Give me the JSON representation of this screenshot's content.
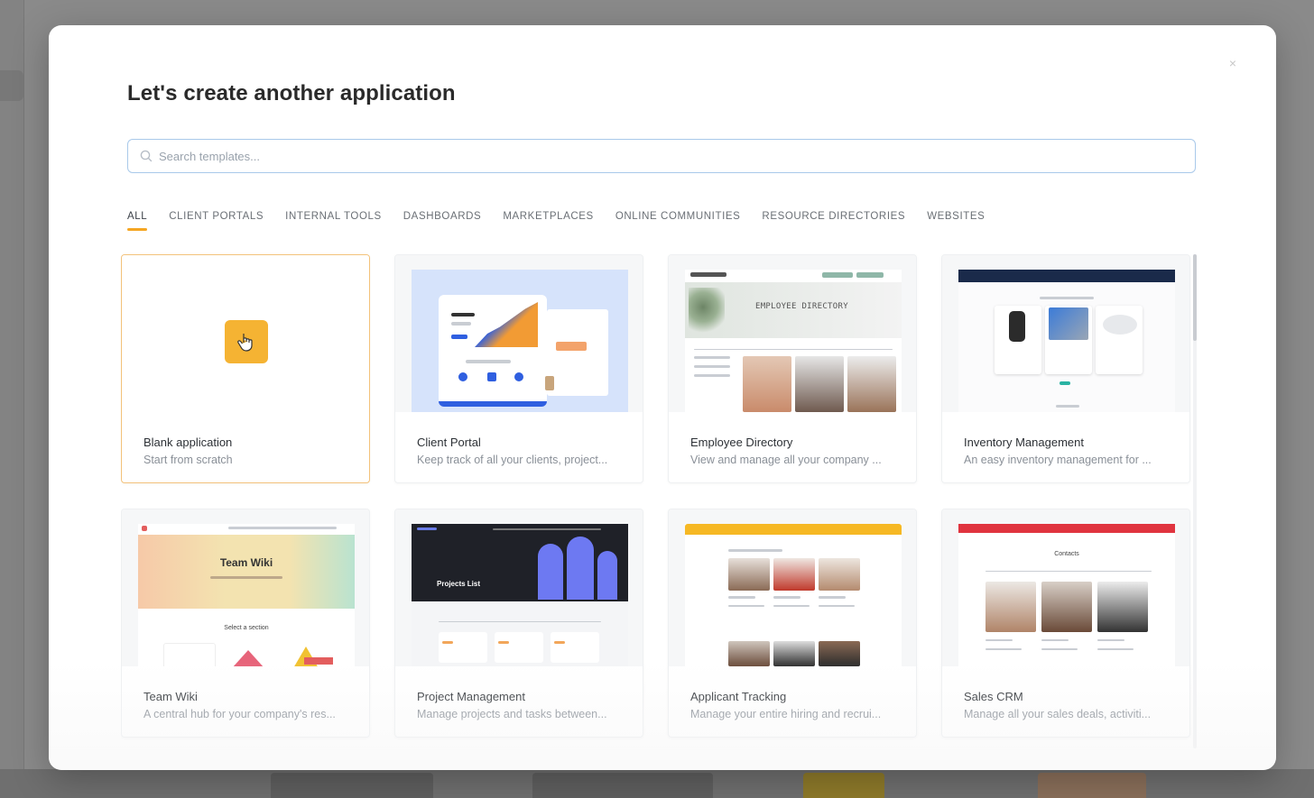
{
  "modal": {
    "title": "Let's create another application",
    "close_label": "×"
  },
  "search": {
    "placeholder": "Search templates...",
    "value": ""
  },
  "tabs": [
    {
      "label": "ALL",
      "active": true
    },
    {
      "label": "CLIENT PORTALS",
      "active": false
    },
    {
      "label": "INTERNAL TOOLS",
      "active": false
    },
    {
      "label": "DASHBOARDS",
      "active": false
    },
    {
      "label": "MARKETPLACES",
      "active": false
    },
    {
      "label": "ONLINE COMMUNITIES",
      "active": false
    },
    {
      "label": "RESOURCE DIRECTORIES",
      "active": false
    },
    {
      "label": "WEBSITES",
      "active": false
    }
  ],
  "templates": [
    {
      "title": "Blank application",
      "description": "Start from scratch",
      "icon": "pointer-hand-icon"
    },
    {
      "title": "Client Portal",
      "description": "Keep track of all your clients, project..."
    },
    {
      "title": "Employee Directory",
      "description": "View and manage all your company ...",
      "thumb_heading": "EMPLOYEE DIRECTORY"
    },
    {
      "title": "Inventory Management",
      "description": "An easy inventory management for ..."
    },
    {
      "title": "Team Wiki",
      "description": "A central hub for your company's res...",
      "thumb_heading": "Team Wiki",
      "thumb_sub": "Select a section"
    },
    {
      "title": "Project Management",
      "description": "Manage projects and tasks between...",
      "thumb_heading": "Projects List"
    },
    {
      "title": "Applicant Tracking",
      "description": "Manage your entire hiring and recrui..."
    },
    {
      "title": "Sales CRM",
      "description": "Manage all your sales deals, activiti...",
      "thumb_heading": "Contacts"
    }
  ],
  "colors": {
    "accent": "#f5a623",
    "search_border": "#a9c9ea",
    "blank_icon": "#f5b333"
  }
}
